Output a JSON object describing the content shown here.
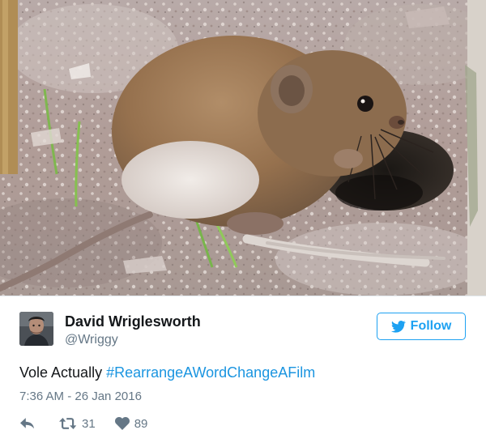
{
  "tweet": {
    "author": {
      "display_name": "David Wriglesworth",
      "handle": "@Wriggy"
    },
    "follow_label": "Follow",
    "text_prefix": "Vole Actually ",
    "hashtag": "#RearrangeAWordChangeAFilm",
    "timestamp": "7:36 AM - 26 Jan 2016",
    "retweet_count": "31",
    "like_count": "89",
    "icons": {
      "reply": "reply-icon",
      "retweet": "retweet-icon",
      "like": "heart-icon",
      "follow": "bird-icon"
    }
  },
  "colors": {
    "twitter_blue": "#1da1f2",
    "hashtag_blue": "#1b95e0",
    "secondary_text": "#657786"
  }
}
